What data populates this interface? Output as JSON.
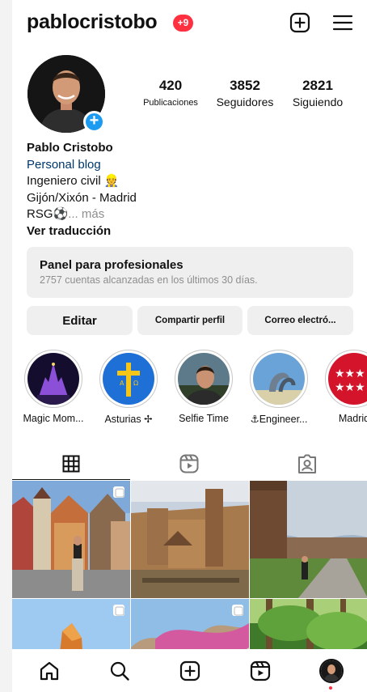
{
  "header": {
    "username": "pablocristobo",
    "notification_badge": "+9",
    "icons": [
      "plus-square-icon",
      "menu-icon"
    ]
  },
  "profile": {
    "stats": [
      {
        "value": "420",
        "label": "Publicaciones"
      },
      {
        "value": "3852",
        "label": "Seguidores"
      },
      {
        "value": "2821",
        "label": "Siguiendo"
      }
    ],
    "name": "Pablo Cristobo",
    "category": "Personal blog",
    "bio_line1": "Ingeniero civil 👷",
    "bio_line2": "Gijón/Xixón - Madrid",
    "bio_line3": "RSG⚽️",
    "more_label": "... más",
    "translate_label": "Ver traducción"
  },
  "pro_panel": {
    "title": "Panel para profesionales",
    "subtitle": "2757 cuentas alcanzadas en los últimos 30 días."
  },
  "buttons": {
    "edit": "Editar",
    "share": "Compartir perfil",
    "email": "Correo electró..."
  },
  "highlights": [
    {
      "label": "Magic Mom..."
    },
    {
      "label": "Asturias ✢"
    },
    {
      "label": "Selfie Time"
    },
    {
      "label": "⚓Engineer..."
    },
    {
      "label": "Madrid"
    }
  ],
  "tabs": [
    "grid-icon",
    "reels-icon",
    "tagged-icon"
  ],
  "nav": [
    "home-icon",
    "search-icon",
    "create-icon",
    "reels-icon",
    "profile-avatar"
  ],
  "colors": {
    "badge": "#ff3040",
    "link": "#00376b",
    "accent": "#1d9bf0",
    "button_bg": "#efefef"
  }
}
